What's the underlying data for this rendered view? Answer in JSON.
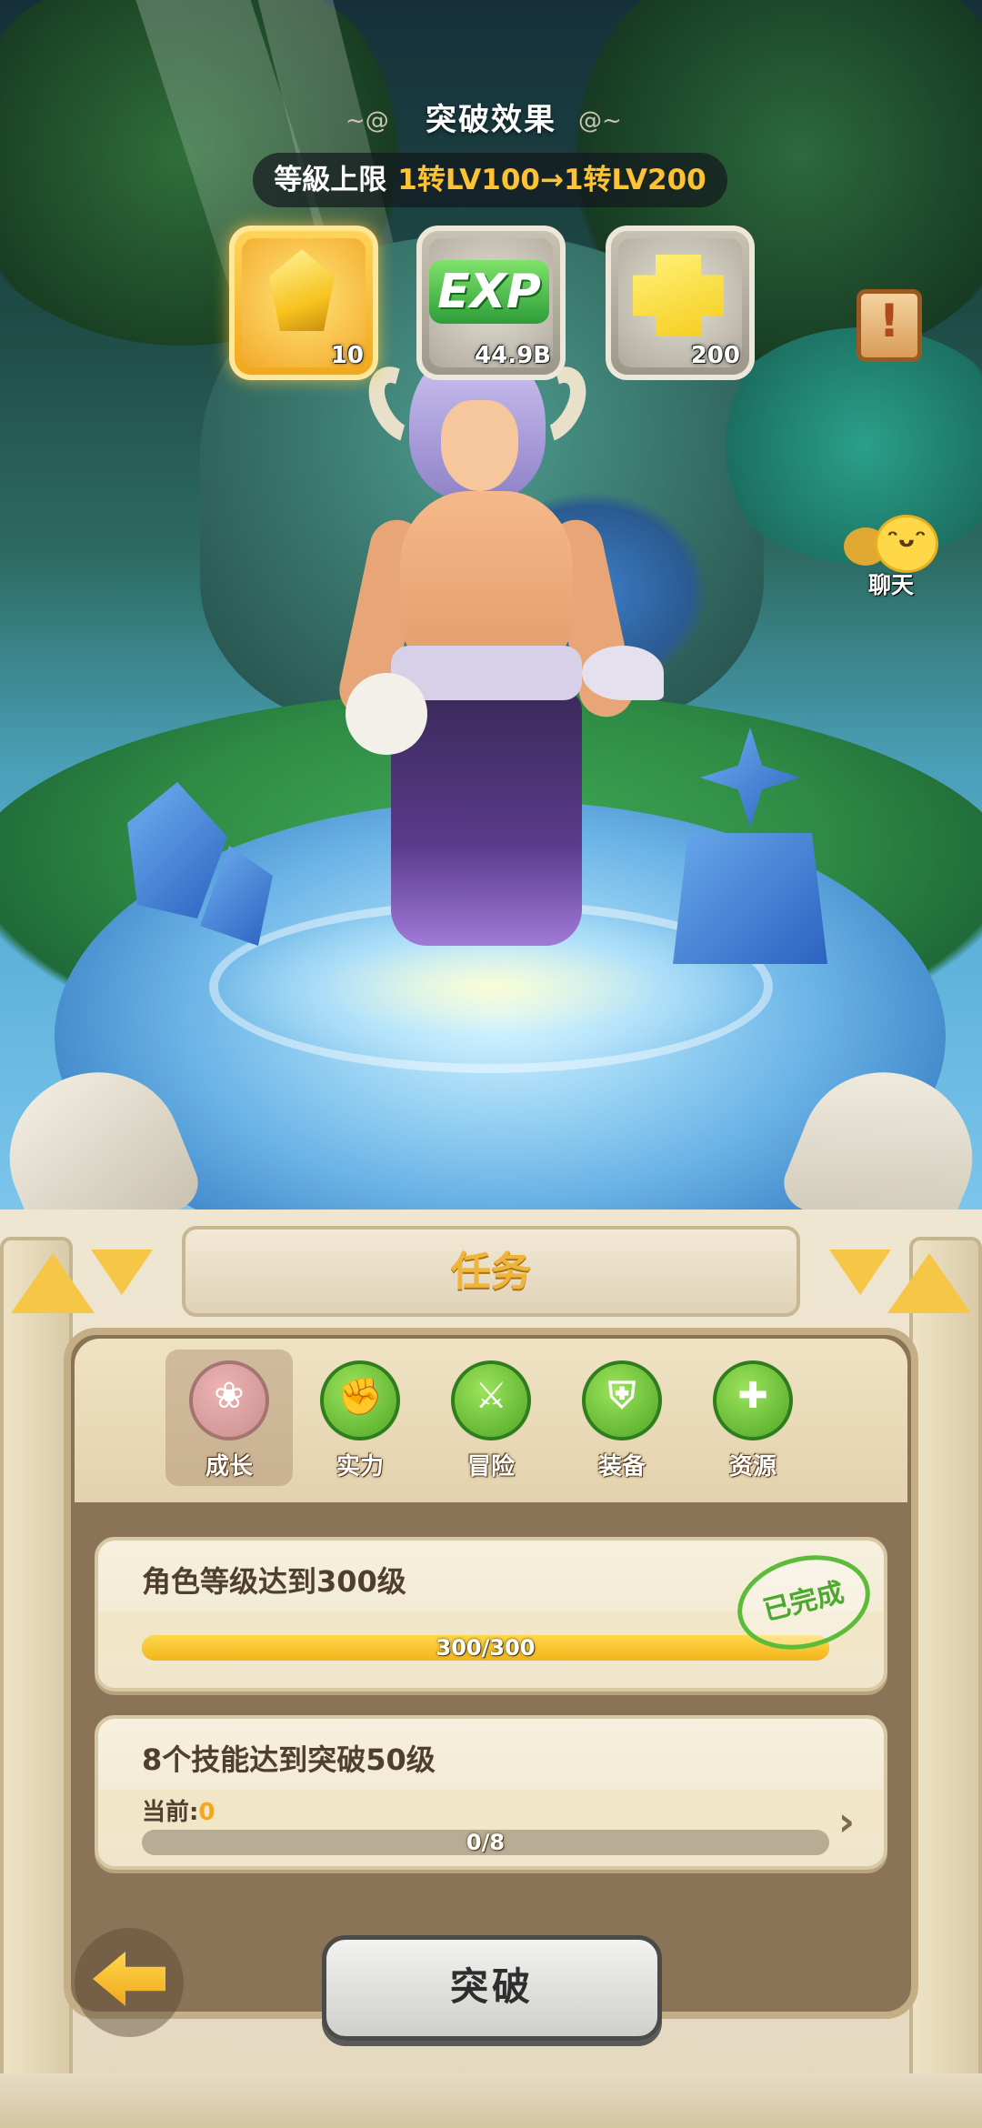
{
  "top": {
    "title": "突破效果",
    "level_cap_label": "等級上限",
    "level_cap_value": "1转LV100→1转LV200"
  },
  "rewards": [
    {
      "icon": "gold-crystal-icon",
      "quantity": "10"
    },
    {
      "icon": "exp-icon",
      "icon_text": "EXP",
      "quantity": "44.9B"
    },
    {
      "icon": "gold-bar-icon",
      "quantity": "200"
    }
  ],
  "side": {
    "scroll_icon": "scroll-icon",
    "chat_label": "聊天"
  },
  "panel": {
    "title": "任务",
    "tabs": [
      {
        "label": "成长",
        "icon": "growth-icon",
        "active": true
      },
      {
        "label": "实力",
        "icon": "strength-icon",
        "active": false
      },
      {
        "label": "冒险",
        "icon": "adventure-icon",
        "active": false
      },
      {
        "label": "装备",
        "icon": "equipment-icon",
        "active": false
      },
      {
        "label": "资源",
        "icon": "resource-icon",
        "active": false
      }
    ],
    "tasks": [
      {
        "title": "角色等级达到300级",
        "progress_text": "300/300",
        "progress_fraction": 1.0,
        "completed_stamp": "已完成"
      },
      {
        "title": "8个技能达到突破50级",
        "current_label": "当前:",
        "current_value": "0",
        "progress_text": "0/8",
        "progress_fraction": 0.0
      }
    ]
  },
  "actions": {
    "breakthrough_label": "突破",
    "back_icon": "back-arrow-icon"
  },
  "colors": {
    "accent_gold": "#ffc232",
    "complete_green": "#4da82e",
    "panel_beige": "#efe6d2"
  }
}
